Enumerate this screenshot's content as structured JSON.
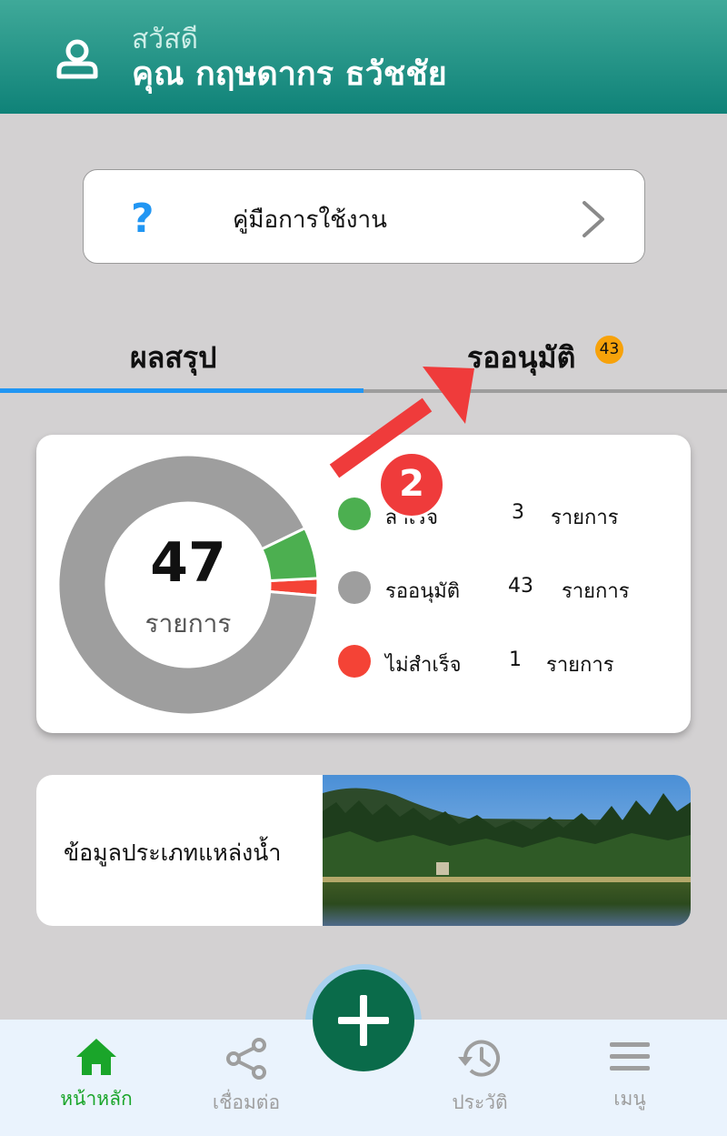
{
  "header": {
    "greeting": "สวัสดี",
    "user_name": "คุณ กฤษดากร ธวัชชัย",
    "icon": "user-icon"
  },
  "guide": {
    "icon": "question-icon",
    "question_mark": "?",
    "label": "คู่มือการใช้งาน",
    "chevron": "chevron-right-icon"
  },
  "tabs": [
    {
      "label": "ผลสรุป",
      "active": true
    },
    {
      "label": "รออนุมัติ",
      "badge": "43",
      "active": false
    }
  ],
  "summary": {
    "total": "47",
    "total_unit": "รายการ",
    "items": [
      {
        "name": "สำเร็จ",
        "count": "3",
        "unit": "รายการ",
        "color": "#4caf50"
      },
      {
        "name": "รออนุมัติ",
        "count": "43",
        "unit": "รายการ",
        "color": "#9e9e9e"
      },
      {
        "name": "ไม่สำเร็จ",
        "count": "1",
        "unit": "รายการ",
        "color": "#f44336"
      }
    ]
  },
  "water_card": {
    "label": "ข้อมูลประเภทแหล่งน้ำ"
  },
  "annotation": {
    "number": "2",
    "color": "#ef3b3b"
  },
  "bottom_nav": {
    "items": [
      {
        "label": "หน้าหลัก",
        "icon": "home-icon",
        "active": true
      },
      {
        "label": "เชื่อมต่อ",
        "icon": "share-icon",
        "active": false
      },
      {
        "label": "ประวัติ",
        "icon": "history-icon",
        "active": false
      },
      {
        "label": "เมนู",
        "icon": "menu-icon",
        "active": false
      }
    ],
    "fab_icon": "plus-icon"
  },
  "colors": {
    "header_top": "#3fa999",
    "header_bottom": "#0f8278",
    "accent_blue": "#2196f3",
    "badge": "#f7a20a",
    "nav_active": "#1aa52a",
    "nav_inactive": "#9e9e9e",
    "fab": "#0a6b4a"
  }
}
